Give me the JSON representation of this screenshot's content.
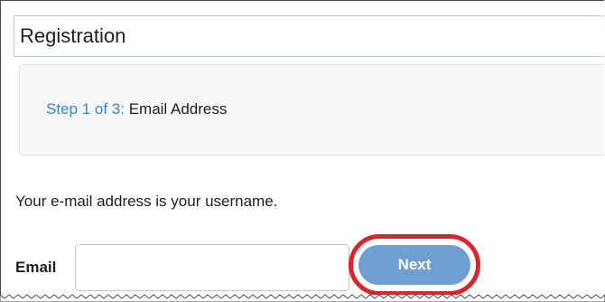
{
  "header": {
    "title": "Registration"
  },
  "step": {
    "label": "Step 1 of 3:",
    "name": "Email Address"
  },
  "form": {
    "help_text": "Your e-mail address is your username.",
    "email_label": "Email",
    "email_value": "",
    "next_label": "Next"
  },
  "colors": {
    "accent": "#3a82c4",
    "button": "#6f9fd2",
    "highlight": "#d7262e"
  }
}
